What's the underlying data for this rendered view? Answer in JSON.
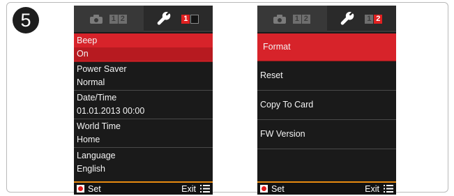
{
  "step_number": "5",
  "left_screen": {
    "tabs": {
      "camera_pages": [
        "1",
        "2"
      ],
      "settings_pages": [
        "1",
        ""
      ]
    },
    "items": [
      {
        "label": "Beep",
        "value": "On"
      },
      {
        "label": "Power Saver",
        "value": "Normal"
      },
      {
        "label": "Date/Time",
        "value": "01.01.2013 00:00"
      },
      {
        "label": "World Time",
        "value": "Home"
      },
      {
        "label": "Language",
        "value": "English"
      }
    ],
    "bottom": {
      "set_label": "Set",
      "exit_label": "Exit"
    }
  },
  "right_screen": {
    "tabs": {
      "camera_pages": [
        "1",
        "2"
      ],
      "settings_pages": [
        "1",
        "2"
      ]
    },
    "items": [
      {
        "label": "Format"
      },
      {
        "label": "Reset"
      },
      {
        "label": "Copy To Card"
      },
      {
        "label": "FW Version"
      }
    ],
    "bottom": {
      "set_label": "Set",
      "exit_label": "Exit"
    }
  },
  "colors": {
    "selected": "#d7232a",
    "accent_line": "#e88a10",
    "screen_bg": "#1a1a1a"
  },
  "icons": [
    "camera-icon",
    "wrench-icon",
    "record-icon",
    "list-icon"
  ]
}
